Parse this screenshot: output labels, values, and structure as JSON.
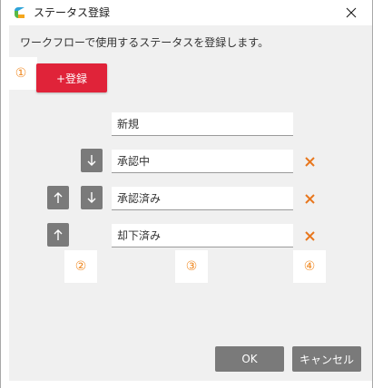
{
  "window": {
    "title": "ステータス登録",
    "close_symbol": "✕"
  },
  "description": "ワークフローで使用するステータスを登録します。",
  "markers": [
    "①",
    "②",
    "③",
    "④"
  ],
  "add_button": {
    "label": "+登録"
  },
  "statuses": [
    {
      "value": "新規",
      "up": false,
      "down": false,
      "deletable": false
    },
    {
      "value": "承認中",
      "up": false,
      "down": true,
      "deletable": true
    },
    {
      "value": "承認済み",
      "up": true,
      "down": true,
      "deletable": true
    },
    {
      "value": "却下済み",
      "up": true,
      "down": false,
      "deletable": true
    }
  ],
  "footer": {
    "ok_label": "OK",
    "cancel_label": "キャンセル"
  },
  "colors": {
    "primary": "#e02339",
    "secondary_button": "#7a7a7a",
    "delete_icon": "#e8771e",
    "marker_text": "#f08a24",
    "background": "#f0f0f0"
  },
  "icons": {
    "app": "app-logo-icon",
    "close": "close-icon",
    "up": "arrow-up-icon",
    "down": "arrow-down-icon",
    "delete": "delete-icon"
  }
}
